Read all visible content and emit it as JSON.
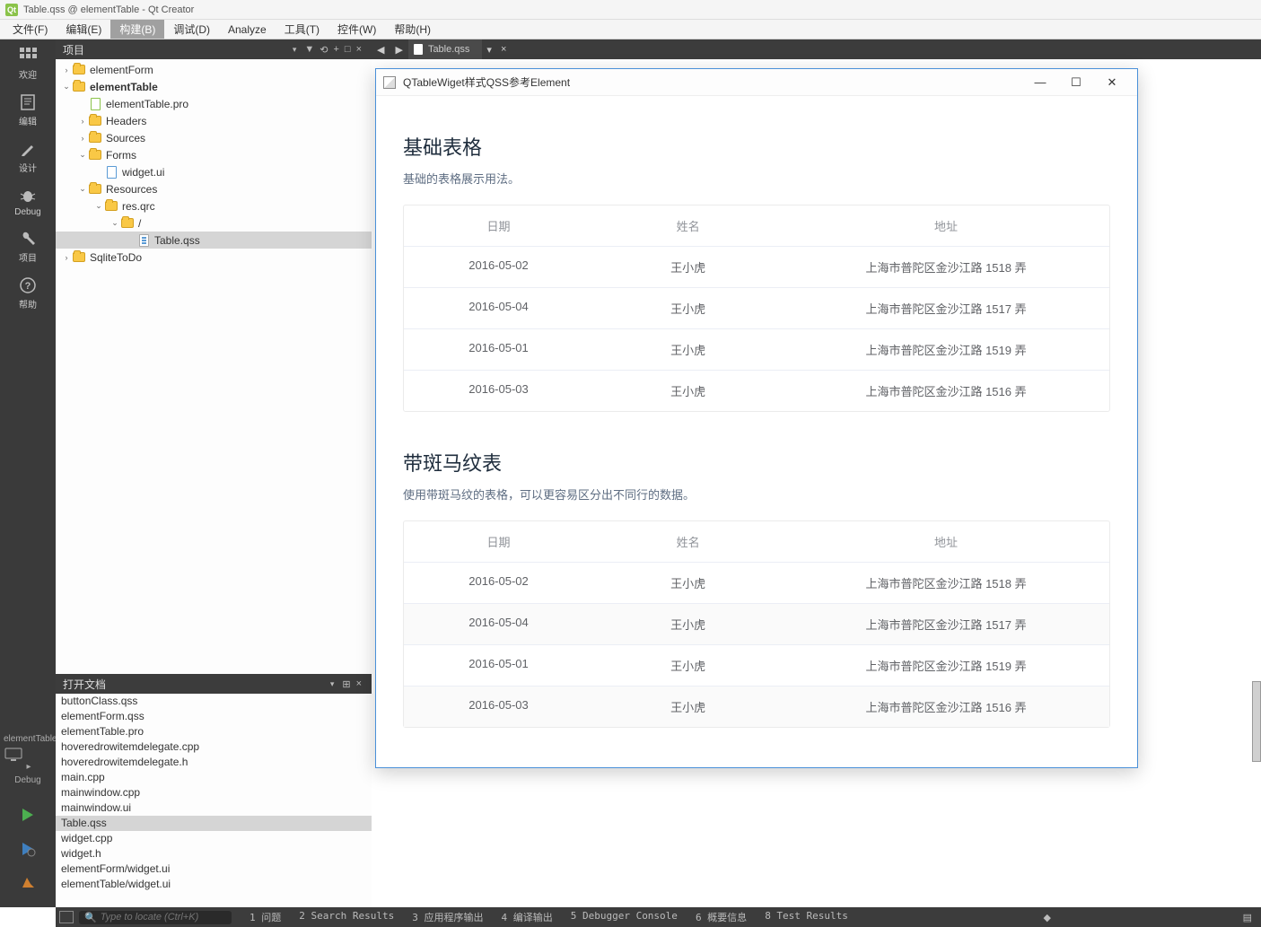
{
  "window": {
    "title": "Table.qss @ elementTable - Qt Creator"
  },
  "menus": [
    "文件(F)",
    "编辑(E)",
    "构建(B)",
    "调试(D)",
    "Analyze",
    "工具(T)",
    "控件(W)",
    "帮助(H)"
  ],
  "menu_active_index": 2,
  "sidebar": {
    "items": [
      {
        "icon": "grid",
        "label": "欢迎"
      },
      {
        "icon": "edit",
        "label": "编辑"
      },
      {
        "icon": "pencil",
        "label": "设计"
      },
      {
        "icon": "bug",
        "label": "Debug"
      },
      {
        "icon": "wrench",
        "label": "项目"
      },
      {
        "icon": "help",
        "label": "帮助"
      }
    ],
    "target": {
      "project": "elementTable",
      "config": "Debug"
    },
    "run_buttons": [
      "play",
      "play-debug",
      "hammer"
    ]
  },
  "project_panel": {
    "title": "项目"
  },
  "tree": [
    {
      "d": 0,
      "tw": ">",
      "ico": "folder",
      "label": "elementForm"
    },
    {
      "d": 0,
      "tw": "v",
      "ico": "folder",
      "label": "elementTable",
      "bold": true
    },
    {
      "d": 1,
      "tw": "",
      "ico": "pro",
      "label": "elementTable.pro"
    },
    {
      "d": 1,
      "tw": ">",
      "ico": "folder",
      "label": "Headers"
    },
    {
      "d": 1,
      "tw": ">",
      "ico": "folder",
      "label": "Sources"
    },
    {
      "d": 1,
      "tw": "v",
      "ico": "folder",
      "label": "Forms"
    },
    {
      "d": 2,
      "tw": "",
      "ico": "ui",
      "label": "widget.ui"
    },
    {
      "d": 1,
      "tw": "v",
      "ico": "folder",
      "label": "Resources"
    },
    {
      "d": 2,
      "tw": "v",
      "ico": "folder",
      "label": "res.qrc"
    },
    {
      "d": 3,
      "tw": "v",
      "ico": "folder",
      "label": "/"
    },
    {
      "d": 4,
      "tw": "",
      "ico": "file",
      "label": "Table.qss",
      "sel": true
    },
    {
      "d": 0,
      "tw": ">",
      "ico": "folder",
      "label": "SqliteToDo"
    }
  ],
  "open_docs": {
    "title": "打开文档",
    "items": [
      "buttonClass.qss",
      "elementForm.qss",
      "elementTable.pro",
      "hoveredrowitemdelegate.cpp",
      "hoveredrowitemdelegate.h",
      "main.cpp",
      "mainwindow.cpp",
      "mainwindow.ui",
      "Table.qss",
      "widget.cpp",
      "widget.h",
      "elementForm/widget.ui",
      "elementTable/widget.ui"
    ],
    "selected": "Table.qss"
  },
  "editor_tabs": {
    "active": "Table.qss"
  },
  "preview": {
    "title": "QTableWiget样式QSS参考Element",
    "section1": {
      "title": "基础表格",
      "desc": "基础的表格展示用法。"
    },
    "section2": {
      "title": "带斑马纹表",
      "desc": "使用带斑马纹的表格，可以更容易区分出不同行的数据。"
    },
    "headers": [
      "日期",
      "姓名",
      "地址"
    ],
    "rows": [
      {
        "d": "2016-05-02",
        "n": "王小虎",
        "a": "上海市普陀区金沙江路 1518 弄"
      },
      {
        "d": "2016-05-04",
        "n": "王小虎",
        "a": "上海市普陀区金沙江路 1517 弄"
      },
      {
        "d": "2016-05-01",
        "n": "王小虎",
        "a": "上海市普陀区金沙江路 1519 弄"
      },
      {
        "d": "2016-05-03",
        "n": "王小虎",
        "a": "上海市普陀区金沙江路 1516 弄"
      }
    ]
  },
  "status": {
    "search_placeholder": "Type to locate (Ctrl+K)",
    "tabs": [
      "1 问题",
      "2 Search Results",
      "3 应用程序输出",
      "4 编译输出",
      "5 Debugger Console",
      "6 概要信息",
      "8 Test Results"
    ]
  }
}
